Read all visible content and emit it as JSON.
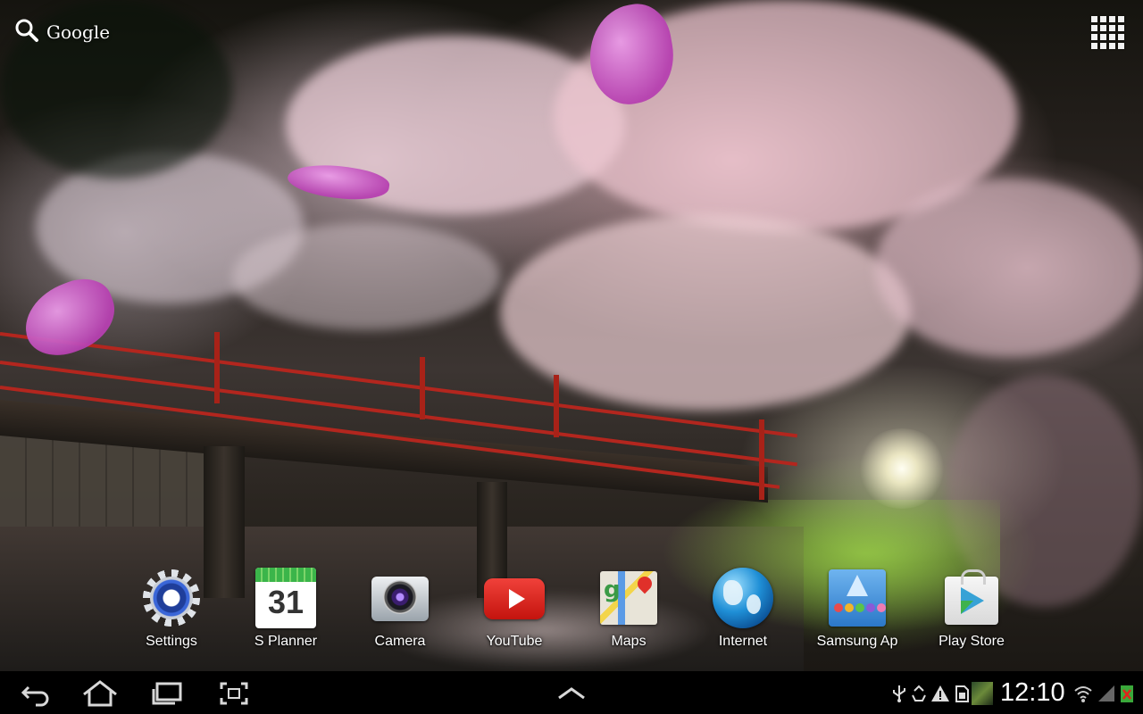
{
  "top_bar": {
    "search_label": "Google",
    "search_icon": "search-icon",
    "apps_icon": "apps-grid-icon"
  },
  "dock_apps": [
    {
      "label": "Settings",
      "icon": "settings-gear-icon"
    },
    {
      "label": "S Planner",
      "icon": "calendar-icon",
      "date": "31"
    },
    {
      "label": "Camera",
      "icon": "camera-icon"
    },
    {
      "label": "YouTube",
      "icon": "youtube-icon"
    },
    {
      "label": "Maps",
      "icon": "maps-icon"
    },
    {
      "label": "Internet",
      "icon": "globe-icon"
    },
    {
      "label": "Samsung Ap",
      "icon": "samsung-apps-icon"
    },
    {
      "label": "Play Store",
      "icon": "play-store-icon"
    }
  ],
  "system_bar": {
    "nav": [
      "back-icon",
      "home-icon",
      "recent-apps-icon",
      "screenshot-icon"
    ],
    "center": "chevron-up-icon",
    "clock": "12:10",
    "status_icons": [
      "usb-icon",
      "recycle-icon",
      "warning-icon",
      "sd-card-icon",
      "image-thumbnail-icon",
      "wifi-icon",
      "signal-icon",
      "battery-error-icon"
    ]
  },
  "colors": {
    "bridge_red": "#b3261e",
    "status_bar": "#000000",
    "label_text": "#ffffff"
  }
}
